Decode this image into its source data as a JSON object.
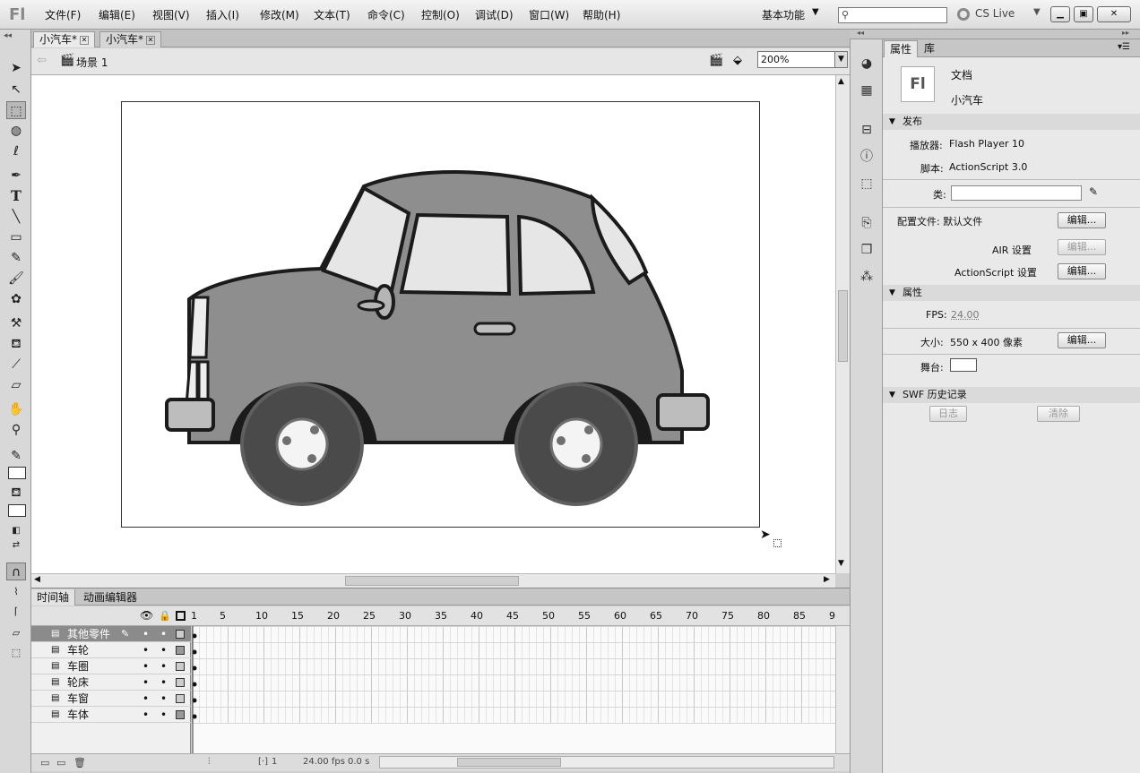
{
  "app": {
    "logo": "Fl"
  },
  "menu": [
    "文件(F)",
    "编辑(E)",
    "视图(V)",
    "插入(I)",
    "修改(M)",
    "文本(T)",
    "命令(C)",
    "控制(O)",
    "调试(D)",
    "窗口(W)",
    "帮助(H)"
  ],
  "workspace": {
    "label": "基本功能"
  },
  "search": {
    "placeholder": ""
  },
  "cslive": {
    "label": "CS Live"
  },
  "doc_tabs": [
    "小汽车*",
    "小汽车*"
  ],
  "editbar": {
    "scene": "场景 1",
    "zoom": "200%"
  },
  "timeline": {
    "tabs": [
      "时间轴",
      "动画编辑器"
    ],
    "frame_numbers": [
      "1",
      "5",
      "10",
      "15",
      "20",
      "25",
      "30",
      "35",
      "40",
      "45",
      "50",
      "55",
      "60",
      "65",
      "70",
      "75",
      "80",
      "85",
      "9"
    ],
    "layers": [
      {
        "name": "其他零件",
        "selected": true
      },
      {
        "name": "车轮",
        "selected": false
      },
      {
        "name": "车圈",
        "selected": false
      },
      {
        "name": "轮床",
        "selected": false
      },
      {
        "name": "车窗",
        "selected": false
      },
      {
        "name": "车体",
        "selected": false
      }
    ],
    "footer": {
      "frame": "1",
      "fps": "24.00",
      "fps_unit": "fps",
      "time": "0.0 s"
    }
  },
  "properties": {
    "tabs": [
      "属性",
      "库"
    ],
    "doc_icon": "Fl",
    "doc_type": "文档",
    "doc_name": "小汽车",
    "publish_title": "发布",
    "player_label": "播放器:",
    "player_value": "Flash Player 10",
    "script_label": "脚本:",
    "script_value": "ActionScript 3.0",
    "class_label": "类:",
    "profile_label": "配置文件:",
    "profile_value": "默认文件",
    "edit_btn": "编辑...",
    "air_label": "AIR 设置",
    "as_label": "ActionScript 设置",
    "props_title": "属性",
    "fps_label": "FPS:",
    "fps_value": "24.00",
    "size_label": "大小:",
    "size_value": "550 x 400 像素",
    "stage_label": "舞台:",
    "swf_title": "SWF 历史记录",
    "log_btn": "日志",
    "clear_btn": "清除"
  }
}
